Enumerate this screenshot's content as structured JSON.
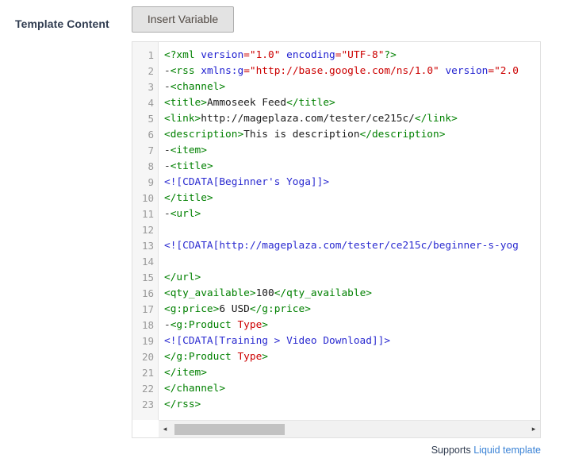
{
  "field": {
    "label": "Template Content"
  },
  "toolbar": {
    "insert_variable_label": "Insert Variable"
  },
  "editor": {
    "language": "xml",
    "line_numbers": [
      "1",
      "2",
      "3",
      "4",
      "5",
      "6",
      "7",
      "8",
      "9",
      "10",
      "11",
      "12",
      "13",
      "14",
      "15",
      "16",
      "17",
      "18",
      "19",
      "20",
      "21",
      "22",
      "23"
    ],
    "scrollbar": {
      "orientation": "horizontal",
      "left_arrow": "◂",
      "right_arrow": "▸",
      "thumb_position_pct": 0,
      "thumb_width_pct": 31
    },
    "lines": [
      {
        "n": "1",
        "tokens": [
          {
            "c": "punct",
            "t": "<?xml "
          },
          {
            "c": "attr",
            "t": "version"
          },
          {
            "c": "val",
            "t": "=\"1.0\""
          },
          {
            "c": "punct",
            "t": " "
          },
          {
            "c": "attr",
            "t": "encoding"
          },
          {
            "c": "val",
            "t": "=\"UTF-8\""
          },
          {
            "c": "punct",
            "t": "?>"
          }
        ]
      },
      {
        "n": "2",
        "tokens": [
          {
            "c": "fold",
            "t": "-"
          },
          {
            "c": "tag",
            "t": "<rss "
          },
          {
            "c": "attr",
            "t": "xmlns:g"
          },
          {
            "c": "val",
            "t": "=\"http://base.google.com/ns/1.0\""
          },
          {
            "c": "tag",
            "t": " "
          },
          {
            "c": "attr",
            "t": "version"
          },
          {
            "c": "val",
            "t": "=\"2.0"
          }
        ]
      },
      {
        "n": "3",
        "tokens": [
          {
            "c": "fold",
            "t": "-"
          },
          {
            "c": "tag",
            "t": "<channel>"
          }
        ]
      },
      {
        "n": "4",
        "tokens": [
          {
            "c": "tag",
            "t": "<title>"
          },
          {
            "c": "txt",
            "t": "Ammoseek Feed"
          },
          {
            "c": "tag",
            "t": "</title>"
          }
        ]
      },
      {
        "n": "5",
        "tokens": [
          {
            "c": "tag",
            "t": "<link>"
          },
          {
            "c": "txt",
            "t": "http://mageplaza.com/tester/ce215c/"
          },
          {
            "c": "tag",
            "t": "</link>"
          }
        ]
      },
      {
        "n": "6",
        "tokens": [
          {
            "c": "tag",
            "t": "<description>"
          },
          {
            "c": "txt",
            "t": "This is description"
          },
          {
            "c": "tag",
            "t": "</description>"
          }
        ]
      },
      {
        "n": "7",
        "tokens": [
          {
            "c": "fold",
            "t": "-"
          },
          {
            "c": "tag",
            "t": "<item>"
          }
        ]
      },
      {
        "n": "8",
        "tokens": [
          {
            "c": "fold",
            "t": "-"
          },
          {
            "c": "tag",
            "t": "<title>"
          }
        ]
      },
      {
        "n": "9",
        "tokens": [
          {
            "c": "cdata",
            "t": "<![CDATA[Beginner's Yoga]]>"
          }
        ]
      },
      {
        "n": "10",
        "tokens": [
          {
            "c": "tag",
            "t": "</title>"
          }
        ]
      },
      {
        "n": "11",
        "tokens": [
          {
            "c": "fold",
            "t": "-"
          },
          {
            "c": "tag",
            "t": "<url>"
          }
        ]
      },
      {
        "n": "12",
        "tokens": [
          {
            "c": "txt",
            "t": ""
          }
        ]
      },
      {
        "n": "13",
        "tokens": [
          {
            "c": "cdata",
            "t": "<![CDATA[http://mageplaza.com/tester/ce215c/beginner-s-yog"
          }
        ]
      },
      {
        "n": "14",
        "tokens": [
          {
            "c": "txt",
            "t": ""
          }
        ]
      },
      {
        "n": "15",
        "tokens": [
          {
            "c": "tag",
            "t": "</url>"
          }
        ]
      },
      {
        "n": "16",
        "tokens": [
          {
            "c": "tag",
            "t": "<qty_available>"
          },
          {
            "c": "txt",
            "t": "100"
          },
          {
            "c": "tag",
            "t": "</qty_available>"
          }
        ]
      },
      {
        "n": "17",
        "tokens": [
          {
            "c": "tag",
            "t": "<g:price>"
          },
          {
            "c": "txt",
            "t": "6 USD"
          },
          {
            "c": "tag",
            "t": "</g:price>"
          }
        ]
      },
      {
        "n": "18",
        "tokens": [
          {
            "c": "fold",
            "t": "-"
          },
          {
            "c": "tag",
            "t": "<g:Product "
          },
          {
            "c": "val",
            "t": "Type"
          },
          {
            "c": "tag",
            "t": ">"
          }
        ]
      },
      {
        "n": "19",
        "tokens": [
          {
            "c": "cdata",
            "t": "<![CDATA[Training > Video Download]]>"
          }
        ]
      },
      {
        "n": "20",
        "tokens": [
          {
            "c": "tag",
            "t": "</g:Product "
          },
          {
            "c": "val",
            "t": "Type"
          },
          {
            "c": "tag",
            "t": ">"
          }
        ]
      },
      {
        "n": "21",
        "tokens": [
          {
            "c": "tag",
            "t": "</item>"
          }
        ]
      },
      {
        "n": "22",
        "tokens": [
          {
            "c": "tag",
            "t": "</channel>"
          }
        ]
      },
      {
        "n": "23",
        "tokens": [
          {
            "c": "tag",
            "t": "</rss>"
          }
        ]
      }
    ]
  },
  "footer": {
    "supports_text": "Supports ",
    "link_label": "Liquid template"
  },
  "colors": {
    "tag": "#008000",
    "attribute": "#2020d0",
    "value": "#cc0000",
    "cdata": "#2a2ad0",
    "text": "#1a1a1a",
    "label": "#303c50",
    "link": "#3b83d6",
    "button_bg": "#e3e3e3",
    "button_border": "#adadad",
    "gutter_bg": "#f6f6f6",
    "scrollbar_thumb": "#c2c2c2"
  }
}
